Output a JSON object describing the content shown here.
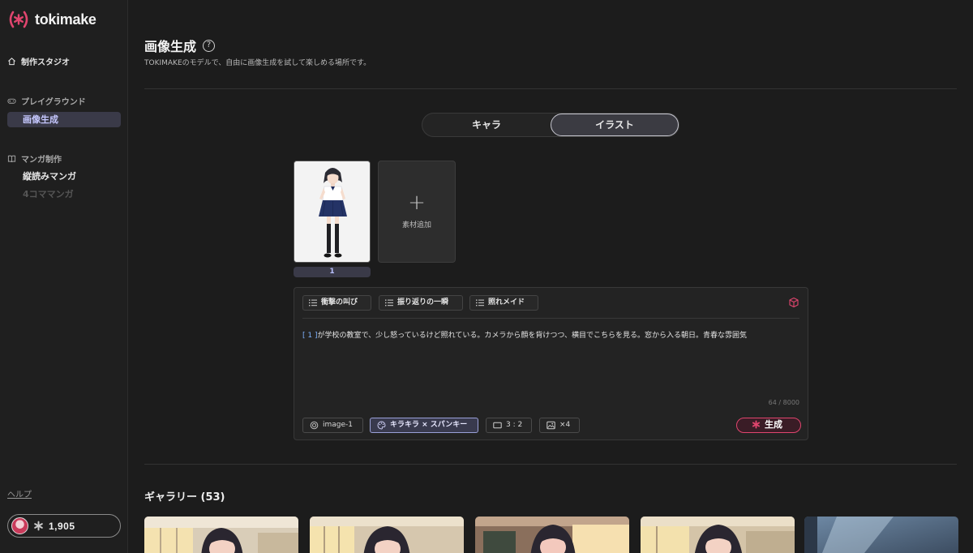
{
  "brand": {
    "name": "tokimake",
    "accent": "#e0456e"
  },
  "sidebar": {
    "studio_label": "制作スタジオ",
    "playground": {
      "label": "プレイグラウンド",
      "items": [
        {
          "label": "画像生成",
          "active": true
        }
      ]
    },
    "manga": {
      "label": "マンガ制作",
      "items": [
        {
          "label": "縦読みマンガ"
        },
        {
          "label": "4コママンガ",
          "disabled": true
        }
      ]
    },
    "help_label": "ヘルプ",
    "credits": "1,905"
  },
  "header": {
    "title": "画像生成",
    "help_icon": "?",
    "subtitle": "TOKIMAKEのモデルで、自由に画像生成を試して楽しめる場所です。"
  },
  "mode_tabs": [
    {
      "label": "キャラ",
      "active": false
    },
    {
      "label": "イラスト",
      "active": true
    }
  ],
  "materials": {
    "items": [
      {
        "label": "1"
      }
    ],
    "add_label": "素材追加",
    "add_icon": "+"
  },
  "prompt": {
    "presets": [
      "衝撃の叫び",
      "振り返りの一瞬",
      "照れメイド"
    ],
    "tag": "[ 1 ]",
    "text": "が学校の教室で、少し怒っているけど照れている。カメラから顔を背けつつ、横目でこちらを見る。窓から入る朝日。青春な雰囲気",
    "counter": "64 / 8000",
    "model": "image-1",
    "style": "キラキラ × スパンキー",
    "ratio": "3 : 2",
    "count": "×4",
    "generate_label": "生成"
  },
  "gallery": {
    "title": "ギャラリー (53)"
  }
}
